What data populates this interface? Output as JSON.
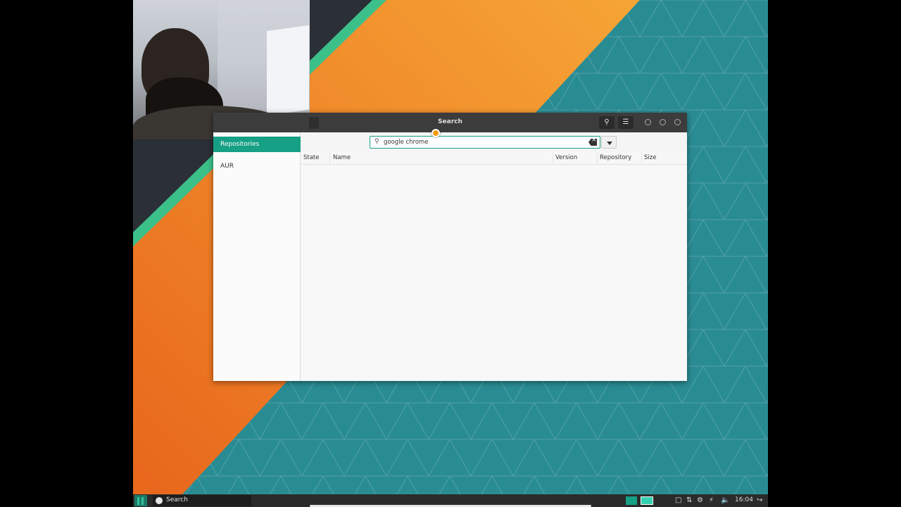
{
  "window": {
    "title": "Search"
  },
  "sidebar": {
    "items": [
      {
        "label": "Repositories",
        "active": true
      },
      {
        "label": "AUR",
        "active": false
      }
    ]
  },
  "search": {
    "value": "google chrome",
    "placeholder": ""
  },
  "table": {
    "columns": [
      "State",
      "Name",
      "Version",
      "Repository",
      "Size"
    ],
    "rows": []
  },
  "taskbar": {
    "task_label": "Search",
    "clock": "16:04"
  },
  "colors": {
    "accent": "#16a085",
    "titlebar": "#3c3c3c",
    "wallpaper_orange": "#f08a24",
    "wallpaper_teal": "#2b8f93"
  },
  "icons": {
    "search": "search-icon",
    "menu": "hamburger-menu-icon",
    "clear": "backspace-clear-icon",
    "dropdown": "chevron-down-icon"
  }
}
